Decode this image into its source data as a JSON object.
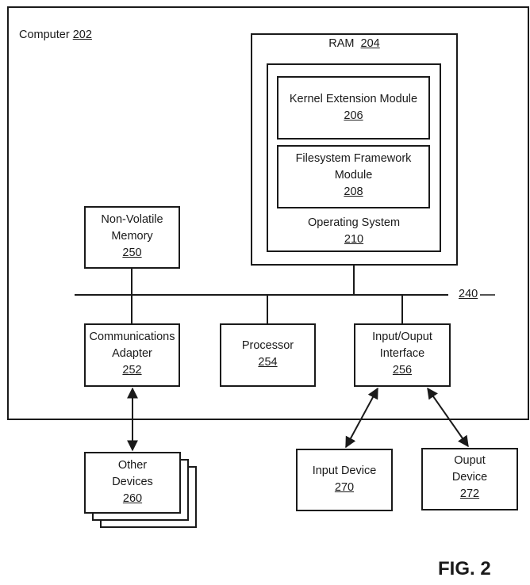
{
  "computer": {
    "label": "Computer",
    "ref": "202"
  },
  "ram": {
    "label": "RAM",
    "ref": "204"
  },
  "kernel": {
    "label": "Kernel Extension Module",
    "ref": "206"
  },
  "filesystem": {
    "line1": "Filesystem Framework",
    "line2": "Module",
    "ref": "208"
  },
  "os": {
    "label": "Operating System",
    "ref": "210"
  },
  "bus": {
    "ref": "240"
  },
  "nvm": {
    "line1": "Non-Volatile",
    "line2": "Memory",
    "ref": "250"
  },
  "comm": {
    "line1": "Communications",
    "line2": "Adapter",
    "ref": "252"
  },
  "processor": {
    "label": "Processor",
    "ref": "254"
  },
  "io": {
    "line1": "Input/Ouput",
    "line2": "Interface",
    "ref": "256"
  },
  "other": {
    "line1": "Other",
    "line2": "Devices",
    "ref": "260"
  },
  "input_dev": {
    "label": "Input Device",
    "ref": "270"
  },
  "output_dev": {
    "line1": "Ouput",
    "line2": "Device",
    "ref": "272"
  },
  "figure": {
    "caption": "FIG. 2"
  }
}
